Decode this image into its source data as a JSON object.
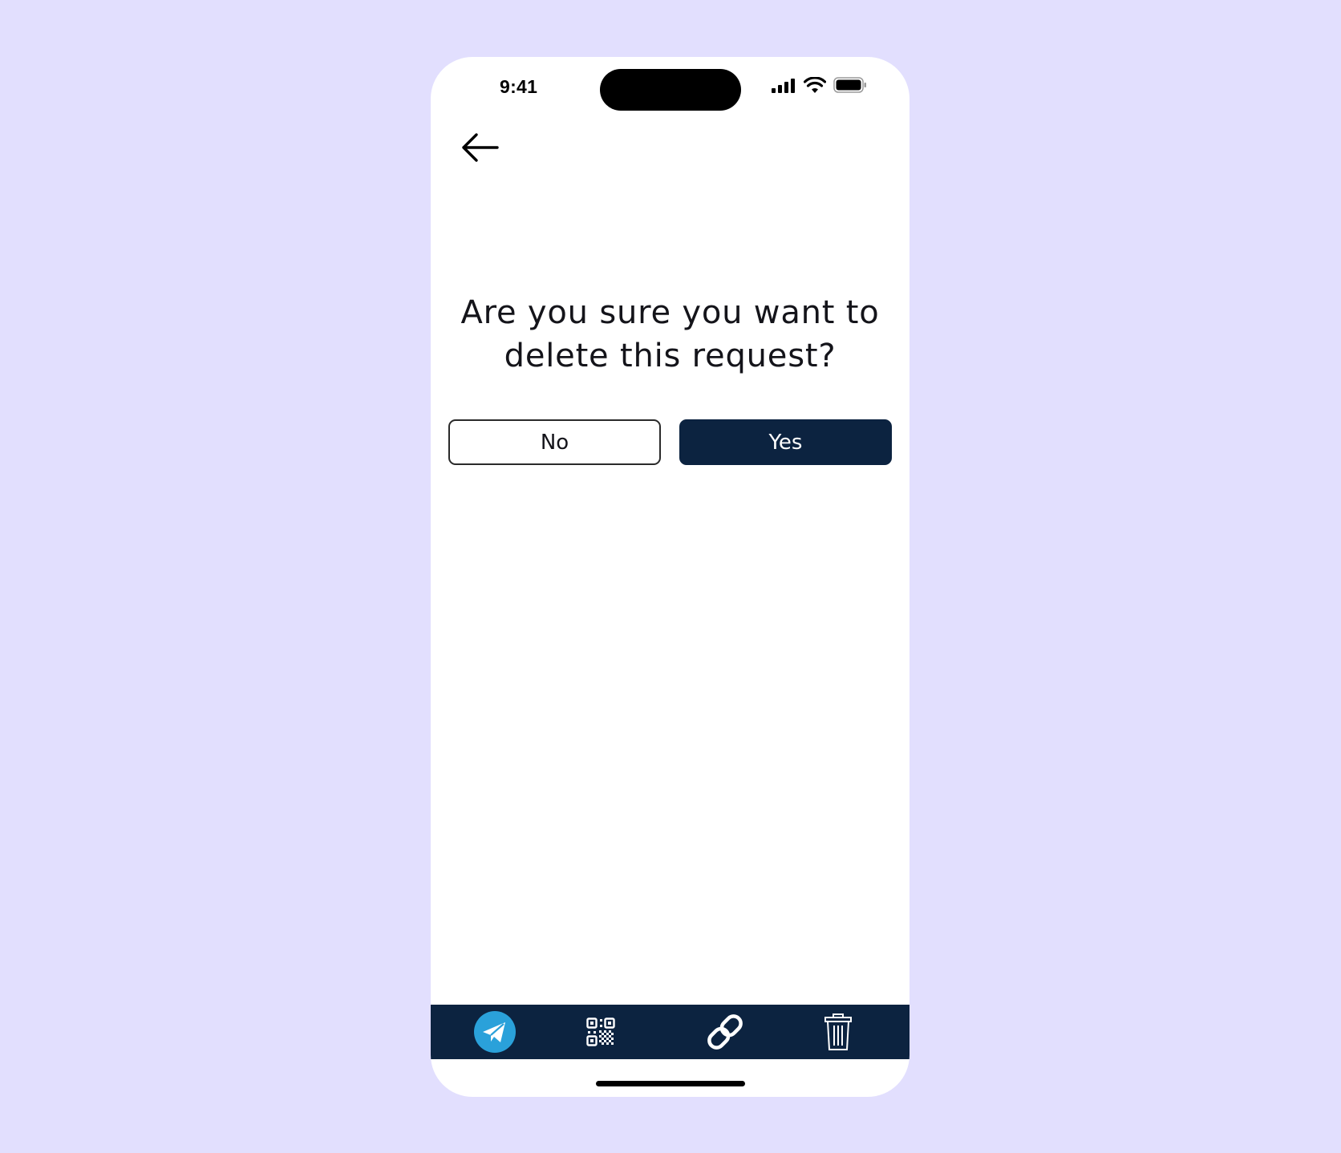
{
  "status_bar": {
    "time": "9:41"
  },
  "nav": {
    "back_icon": "arrow-left-icon"
  },
  "dialog": {
    "question": "Are you sure you want to delete this request?",
    "no_label": "No",
    "yes_label": "Yes"
  },
  "tabbar": {
    "items": [
      {
        "icon": "send-icon",
        "active": true
      },
      {
        "icon": "qr-code-icon",
        "active": false
      },
      {
        "icon": "link-icon",
        "active": false
      },
      {
        "icon": "trash-icon",
        "active": false
      }
    ]
  },
  "colors": {
    "background": "#e2dffe",
    "primary": "#0c2340",
    "accent": "#2aa1da",
    "text": "#14141a"
  }
}
